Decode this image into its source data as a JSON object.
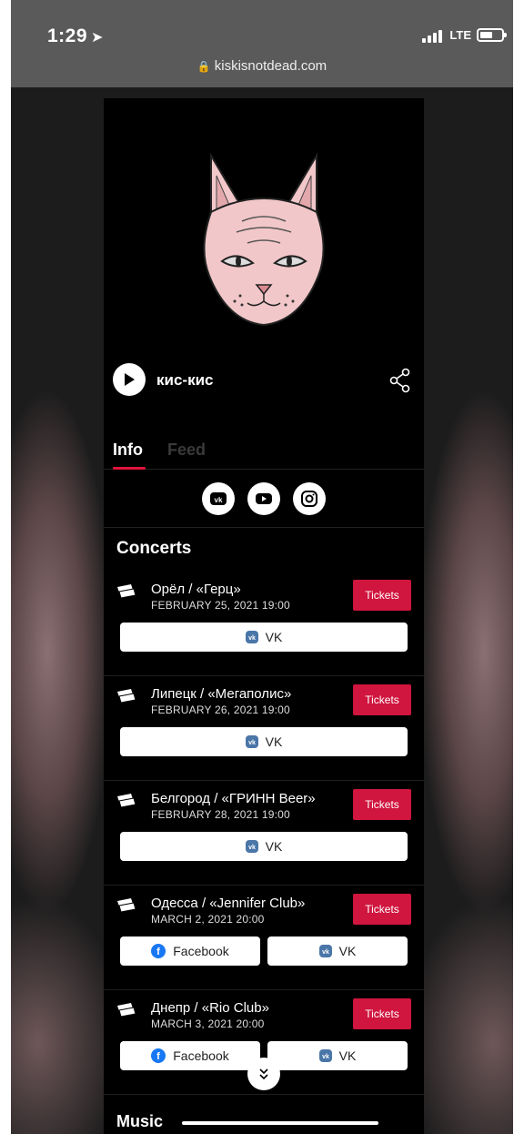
{
  "status": {
    "time": "1:29",
    "network": "LTE",
    "url": "kiskisnotdead.com"
  },
  "artist": {
    "name": "кис-кис"
  },
  "tabs": [
    {
      "label": "Info"
    },
    {
      "label": "Feed"
    }
  ],
  "socials": [
    "vk-icon",
    "youtube-icon",
    "instagram-icon"
  ],
  "concerts": {
    "title": "Concerts",
    "items": [
      {
        "title": "Орёл / «Герц»",
        "date": "FEBRUARY 25, 2021 19:00",
        "tickets": "Tickets",
        "links": [
          "VK"
        ]
      },
      {
        "title": "Липецк / «Мегаполис»",
        "date": "FEBRUARY 26, 2021 19:00",
        "tickets": "Tickets",
        "links": [
          "VK"
        ]
      },
      {
        "title": "Белгород / «ГРИНН Beer»",
        "date": "FEBRUARY 28, 2021 19:00",
        "tickets": "Tickets",
        "links": [
          "VK"
        ]
      },
      {
        "title": "Одесса / «Jennifer Club»",
        "date": "MARCH 2, 2021 20:00",
        "tickets": "Tickets",
        "links": [
          "Facebook",
          "VK"
        ]
      },
      {
        "title": "Днепр / «Rio Club»",
        "date": "MARCH 3, 2021 20:00",
        "tickets": "Tickets",
        "links": [
          "Facebook",
          "VK"
        ]
      }
    ]
  },
  "music": {
    "title": "Music"
  },
  "colors": {
    "accent": "#d0153e",
    "background": "#000000",
    "vk": "#4a76a8",
    "facebook": "#1877f2"
  }
}
